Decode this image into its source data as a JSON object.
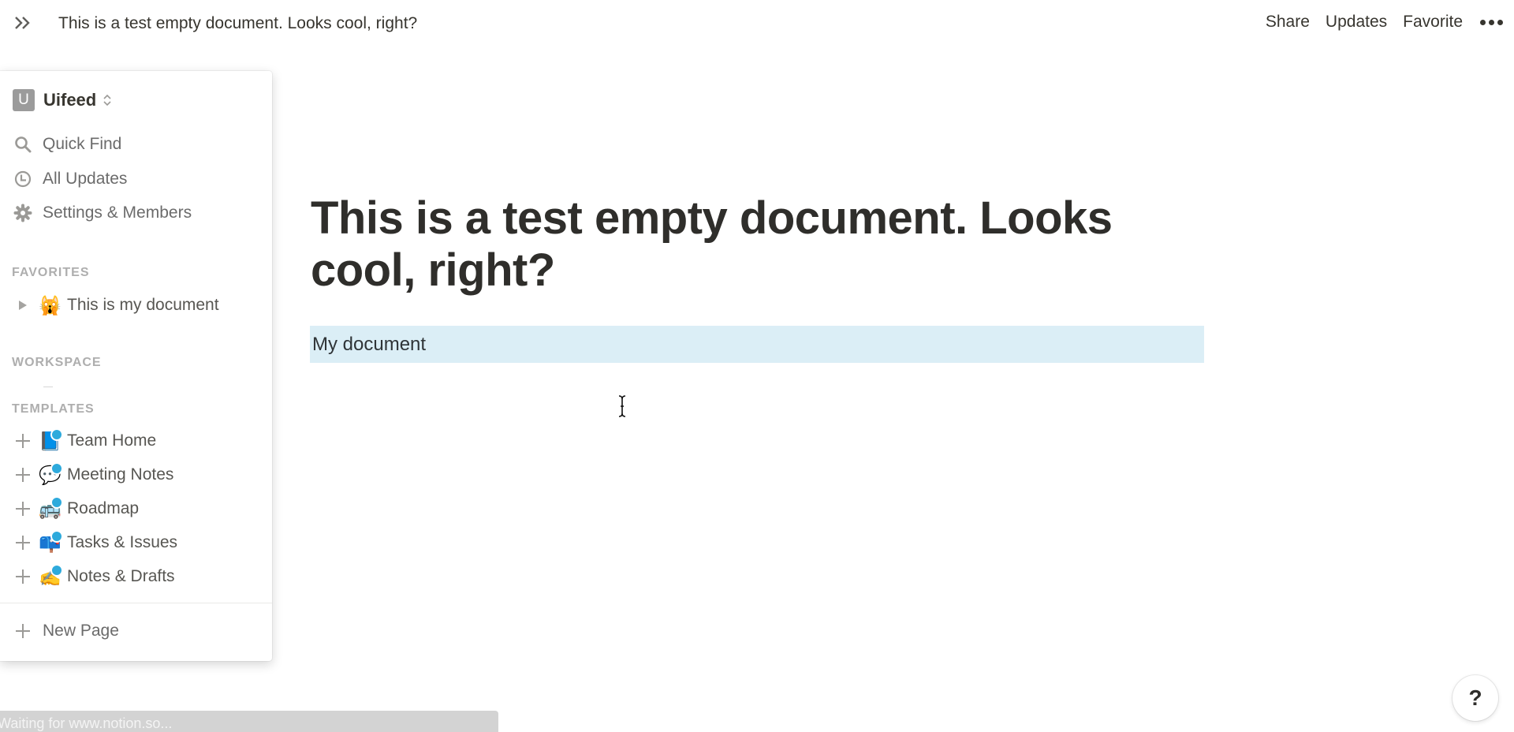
{
  "topbar": {
    "breadcrumb": "This is a test empty document. Looks cool, right?",
    "actions": {
      "share": "Share",
      "updates": "Updates",
      "favorite": "Favorite"
    },
    "icons": {
      "expand": "double-chevron-right-icon",
      "more": "more-horizontal-icon"
    }
  },
  "sidebar": {
    "workspace": {
      "initial": "U",
      "name": "Uifeed"
    },
    "nav": [
      {
        "label": "Quick Find",
        "icon": "search-icon"
      },
      {
        "label": "All Updates",
        "icon": "clock-icon"
      },
      {
        "label": "Settings & Members",
        "icon": "gear-icon"
      }
    ],
    "favorites": {
      "heading": "FAVORITES",
      "items": [
        {
          "label": "This is my document",
          "emoji": "🙀"
        }
      ]
    },
    "workspace_section": {
      "heading": "WORKSPACE"
    },
    "templates": {
      "heading": "TEMPLATES",
      "items": [
        {
          "label": "Team Home",
          "emoji": "📘"
        },
        {
          "label": "Meeting Notes",
          "emoji": "💬"
        },
        {
          "label": "Roadmap",
          "emoji": "🚌"
        },
        {
          "label": "Tasks & Issues",
          "emoji": "📪"
        },
        {
          "label": "Notes & Drafts",
          "emoji": "✍️"
        }
      ]
    },
    "new_page": "New Page"
  },
  "document": {
    "title": "This is a test empty document. Looks cool, right?",
    "blocks": [
      {
        "text": "My document",
        "highlight": "#dbeef6"
      }
    ]
  },
  "help_button": "?",
  "status_bar": "Waiting for www.notion.so..."
}
